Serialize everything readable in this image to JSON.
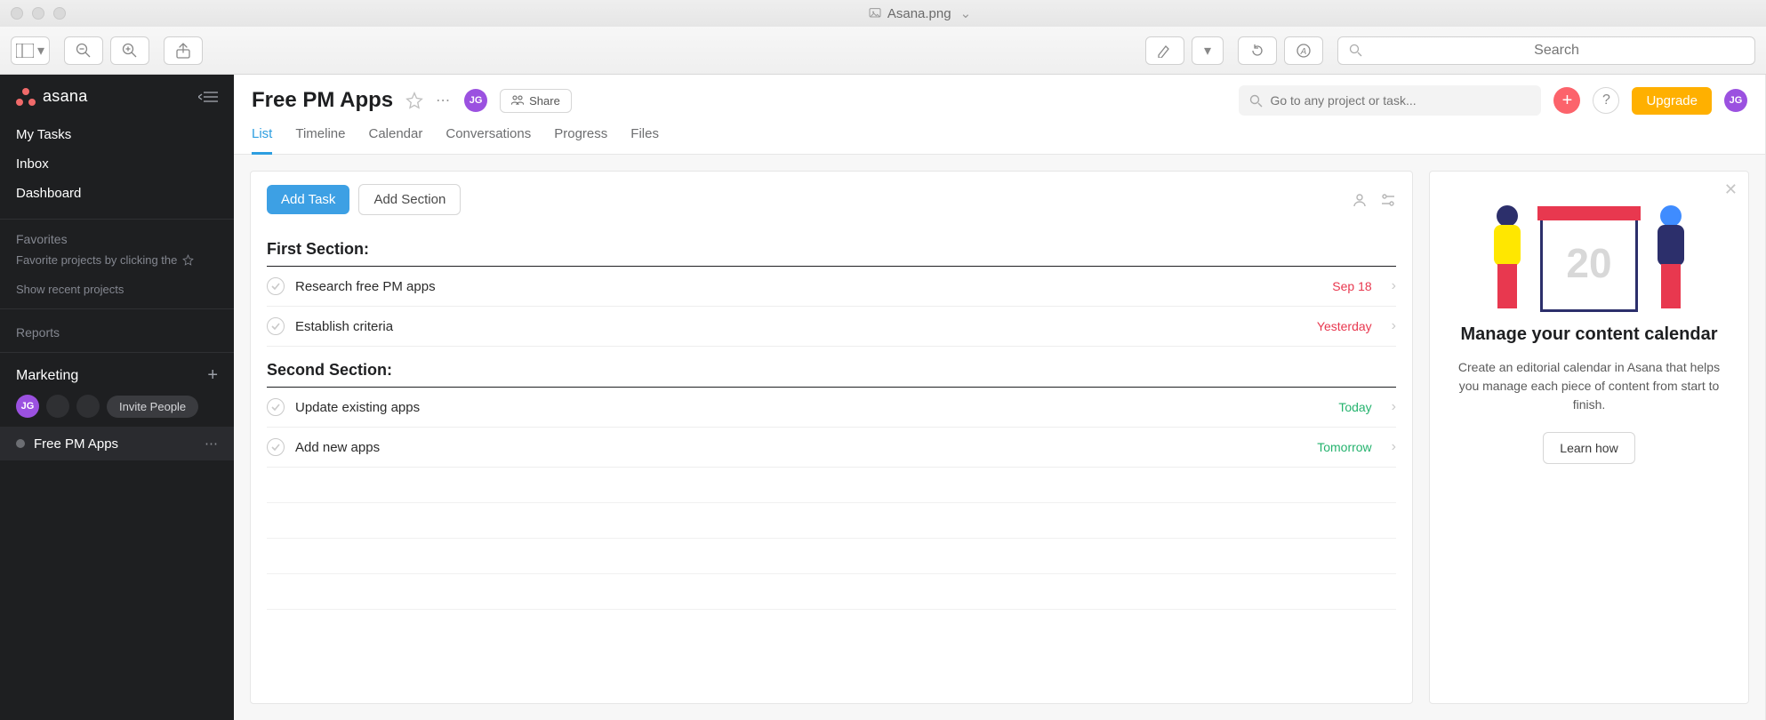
{
  "window": {
    "filename": "Asana.png",
    "search_placeholder": "Search"
  },
  "sidebar": {
    "brand": "asana",
    "nav": [
      "My Tasks",
      "Inbox",
      "Dashboard"
    ],
    "favorites_label": "Favorites",
    "favorites_hint": "Favorite projects by clicking the",
    "recent_link": "Show recent projects",
    "reports_label": "Reports",
    "team_name": "Marketing",
    "avatar_initials": "JG",
    "invite_label": "Invite People",
    "project_name": "Free PM Apps"
  },
  "header": {
    "project_title": "Free PM Apps",
    "share_label": "Share",
    "search_placeholder": "Go to any project or task...",
    "upgrade_label": "Upgrade",
    "avatar_initials": "JG",
    "tabs": [
      "List",
      "Timeline",
      "Calendar",
      "Conversations",
      "Progress",
      "Files"
    ],
    "active_tab": "List"
  },
  "panel": {
    "add_task": "Add Task",
    "add_section": "Add Section",
    "sections": [
      {
        "title": "First Section:",
        "tasks": [
          {
            "name": "Research free PM apps",
            "date": "Sep 18",
            "date_class": "date-red"
          },
          {
            "name": "Establish criteria",
            "date": "Yesterday",
            "date_class": "date-red"
          }
        ]
      },
      {
        "title": "Second Section:",
        "tasks": [
          {
            "name": "Update existing apps",
            "date": "Today",
            "date_class": "date-green"
          },
          {
            "name": "Add new apps",
            "date": "Tomorrow",
            "date_class": "date-green"
          }
        ]
      }
    ]
  },
  "promo": {
    "cal_number": "20",
    "title": "Manage your content calendar",
    "body": "Create an editorial calendar in Asana that helps you manage each piece of content from start to finish.",
    "cta": "Learn how"
  }
}
